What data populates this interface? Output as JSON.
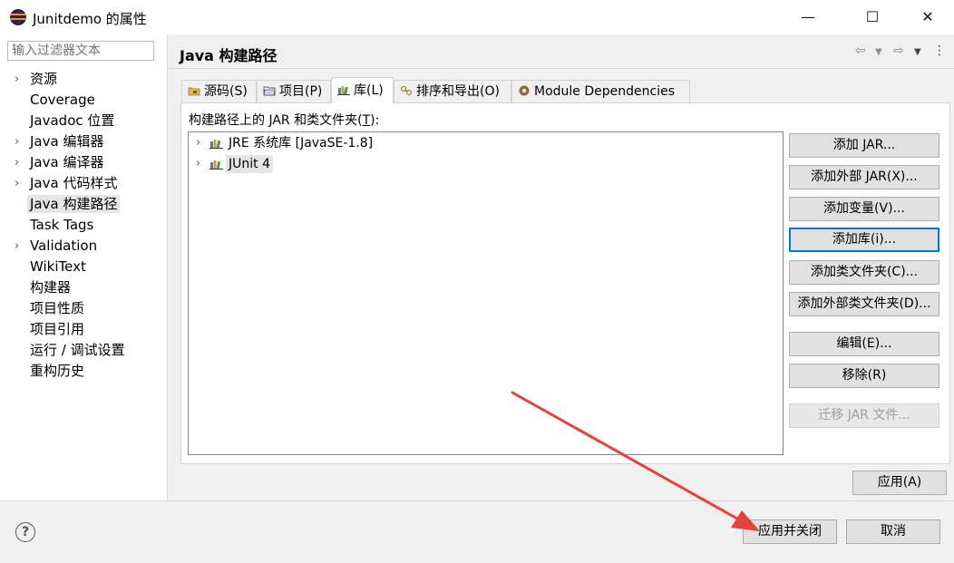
{
  "window": {
    "title": "Junitdemo 的属性",
    "minimize_glyph": "—",
    "maximize_glyph": "☐",
    "close_glyph": "✕"
  },
  "sidebar": {
    "filter_placeholder": "输入过滤器文本",
    "items": [
      {
        "label": "资源",
        "expandable": true
      },
      {
        "label": "Coverage",
        "expandable": false
      },
      {
        "label": "Javadoc 位置",
        "expandable": false
      },
      {
        "label": "Java 编辑器",
        "expandable": true
      },
      {
        "label": "Java 编译器",
        "expandable": true
      },
      {
        "label": "Java 代码样式",
        "expandable": true
      },
      {
        "label": "Java 构建路径",
        "expandable": false,
        "selected": true
      },
      {
        "label": "Task Tags",
        "expandable": false
      },
      {
        "label": "Validation",
        "expandable": true
      },
      {
        "label": "WikiText",
        "expandable": false
      },
      {
        "label": "构建器",
        "expandable": false
      },
      {
        "label": "项目性质",
        "expandable": false
      },
      {
        "label": "项目引用",
        "expandable": false
      },
      {
        "label": "运行 / 调试设置",
        "expandable": false
      },
      {
        "label": "重构历史",
        "expandable": false
      }
    ]
  },
  "header": {
    "title": "Java 构建路径",
    "icons": [
      "back-arrow-icon",
      "dropdown-icon",
      "forward-arrow-icon",
      "dropdown-icon",
      "more-vertical-icon"
    ]
  },
  "tabs": [
    {
      "label": "源码(S)",
      "icon": "source-folder-icon"
    },
    {
      "label": "项目(P)",
      "icon": "project-folder-icon"
    },
    {
      "label": "库(L)",
      "icon": "library-icon",
      "active": true
    },
    {
      "label": "排序和导出(O)",
      "icon": "order-export-icon"
    },
    {
      "label": "Module Dependencies",
      "icon": "module-icon"
    }
  ],
  "libraries": {
    "label_prefix": "构建路径上的 JAR 和类文件夹(",
    "label_mnemonic": "T",
    "label_suffix": "):",
    "items": [
      {
        "label": "JRE 系统库 [JavaSE-1.8]",
        "selected": false
      },
      {
        "label": "JUnit 4",
        "selected": true
      }
    ]
  },
  "buttons": {
    "add_jar": "添加 JAR...",
    "add_external_jar": "添加外部 JAR(X)...",
    "add_variable": "添加变量(V)...",
    "add_library": "添加库(i)...",
    "add_class_folder": "添加类文件夹(C)...",
    "add_external_class_folder": "添加外部类文件夹(D)...",
    "edit": "编辑(E)...",
    "remove": "移除(R)",
    "migrate_jar": "迁移 JAR 文件...",
    "apply": "应用(A)",
    "apply_and_close": "应用并关闭",
    "cancel": "取消"
  },
  "colors": {
    "focus_blue": "#0078d7",
    "annotation_arrow": "#e8413c",
    "selection_bg": "#e5e5e5"
  }
}
